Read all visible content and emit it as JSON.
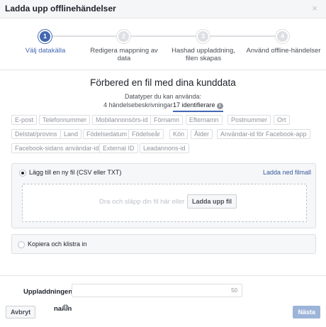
{
  "header": {
    "title": "Ladda upp offlinehändelser",
    "close_label": "×"
  },
  "stepper": {
    "steps": [
      {
        "number": "1",
        "label": "Välj datakälla"
      },
      {
        "number": "2",
        "label": "Redigera mappning av data"
      },
      {
        "number": "3",
        "label": "Hashad uppladdning, filen skapas"
      },
      {
        "number": "4",
        "label": "Använd offline-händelser"
      }
    ]
  },
  "main": {
    "title": "Förbered en fil med dina kunddata",
    "datatypes_caption": "Datatyper du kan använda:",
    "tabs": [
      {
        "label": "4 händelsebeskrivningar"
      },
      {
        "label": "17 identifierare"
      }
    ],
    "identifiers": [
      "E-post",
      "Telefonnummer",
      "Mobilannonsörs-id",
      "Förnamn",
      "Efternamn",
      "Postnummer",
      "Ort",
      "Delstat/provins",
      "Land",
      "Födelsedatum",
      "Födelseår",
      "Kön",
      "Ålder",
      "Användar-id för Facebook-app",
      "Facebook-sidans användar-id",
      "External ID",
      "Leadannons-id"
    ]
  },
  "upload_option": {
    "label": "Lägg till en ny fil (CSV eller TXT)",
    "download_link": "Ladda ned filmall",
    "drop_text": "Dra och släpp din fil här eller",
    "upload_button": "Ladda upp fil"
  },
  "paste_option": {
    "label": "Kopiera och klistra in"
  },
  "footer": {
    "upload_name_label": "Uppladdningens",
    "name_label": "namn",
    "char_count": "50",
    "cancel_button": "Avbryt",
    "next_button": "Nästa"
  },
  "colors": {
    "accent": "#4267b2",
    "link": "#365899",
    "disabled_button": "#9cb4d8"
  }
}
